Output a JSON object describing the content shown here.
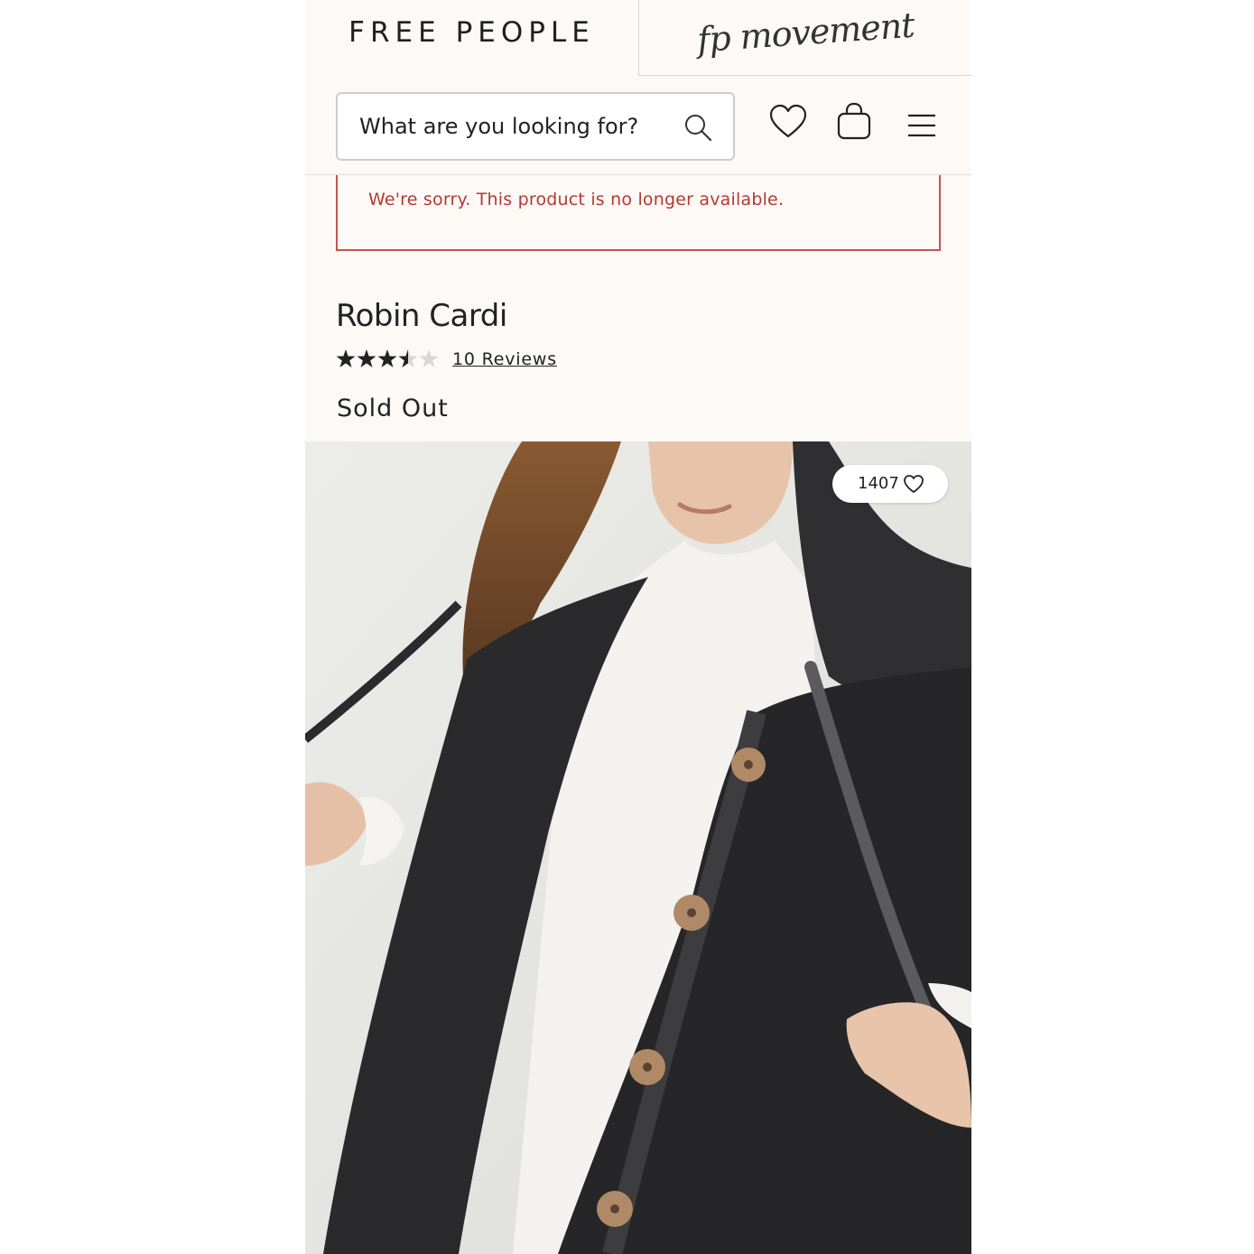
{
  "header": {
    "brand_primary": "FREE PEOPLE",
    "brand_secondary": "fp movement",
    "search": {
      "placeholder": "What are you looking for?"
    },
    "icons": [
      "search-icon",
      "heart-icon",
      "bag-icon",
      "menu-icon"
    ]
  },
  "alert": {
    "message": "We're sorry. This product is no longer available.",
    "color": "#b33a2f"
  },
  "product": {
    "title": "Robin Cardi",
    "rating": 3.5,
    "rating_max": 5,
    "reviews_label": "10 Reviews",
    "availability": "Sold Out",
    "likes": "1407"
  },
  "colors": {
    "page_background": "#fdf9f7",
    "alert_border": "#c5534a",
    "text": "#222222"
  }
}
